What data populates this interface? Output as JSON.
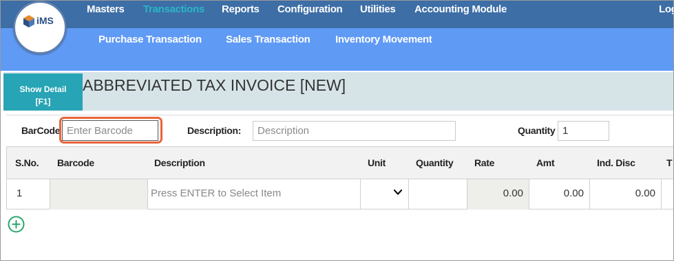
{
  "nav": {
    "logo_text": "iMS",
    "menu": [
      "Masters",
      "Transactions",
      "Reports",
      "Configuration",
      "Utilities",
      "Accounting Module",
      "Log"
    ],
    "active_menu": "Transactions",
    "submenu": [
      "Purchase Transaction",
      "Sales Transaction",
      "Inventory Movement"
    ]
  },
  "header": {
    "show_detail_label": "Show Detail",
    "show_detail_shortcut": "[F1]",
    "title": "ABBREVIATED TAX INVOICE [NEW]"
  },
  "entry": {
    "barcode_label": "BarCode",
    "barcode_placeholder": "Enter Barcode",
    "description_label": "Description:",
    "description_placeholder": "Description",
    "quantity_label": "Quantity",
    "quantity_value": "1"
  },
  "table": {
    "columns": [
      "S.No.",
      "Barcode",
      "Description",
      "Unit",
      "Quantity",
      "Rate",
      "Amt",
      "Ind. Disc",
      "T"
    ],
    "rows": [
      {
        "sno": "1",
        "barcode": "",
        "description_placeholder": "Press ENTER to Select Item",
        "unit": "",
        "quantity": "",
        "rate": "0.00",
        "amt": "0.00",
        "ind_disc": "0.00"
      }
    ]
  },
  "icons": {
    "add": "plus-circle-icon",
    "unit_dropdown": "chevron-down-icon"
  },
  "colors": {
    "topbar": "#3d6ea6",
    "subbar": "#5f9af5",
    "active_menu": "#2bb5c8",
    "show_detail": "#27a4b5",
    "title_band": "#d6e4e8",
    "highlight": "#e8643c",
    "add_icon": "#2aa66a"
  }
}
